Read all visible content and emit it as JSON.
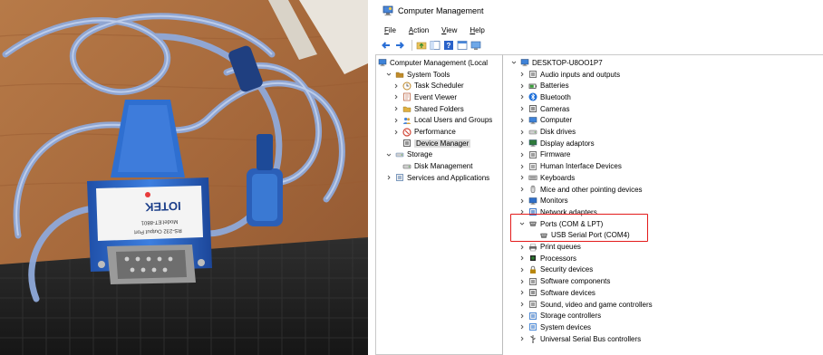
{
  "photo": {
    "adapter_brand": "IOTEK",
    "adapter_model": "Model:ET-8801",
    "adapter_port": "RS-232 Output Port",
    "colors": {
      "wood": "#a86a3c",
      "cable": "#8aa6d8",
      "adapter": "#2e68c8",
      "keyboard": "#242424"
    }
  },
  "window": {
    "title": "Computer Management",
    "menu": [
      "File",
      "Action",
      "View",
      "Help"
    ],
    "toolbar_icons": [
      "back-arrow-icon",
      "forward-arrow-icon",
      "up-folder-icon",
      "show-hide-tree-icon",
      "help-icon",
      "properties-icon",
      "console-icon"
    ],
    "left_tree": [
      {
        "label": "Computer Management (Local",
        "icon": "computer-management-icon",
        "chevron": "",
        "indent": 0
      },
      {
        "label": "System Tools",
        "icon": "tools-icon",
        "chevron": "v",
        "indent": 1
      },
      {
        "label": "Task Scheduler",
        "icon": "clock-icon",
        "chevron": ">",
        "indent": 2
      },
      {
        "label": "Event Viewer",
        "icon": "event-viewer-icon",
        "chevron": ">",
        "indent": 2
      },
      {
        "label": "Shared Folders",
        "icon": "shared-folder-icon",
        "chevron": ">",
        "indent": 2
      },
      {
        "label": "Local Users and Groups",
        "icon": "users-icon",
        "chevron": ">",
        "indent": 2
      },
      {
        "label": "Performance",
        "icon": "performance-icon",
        "chevron": ">",
        "indent": 2
      },
      {
        "label": "Device Manager",
        "icon": "device-manager-icon",
        "chevron": "",
        "indent": 2,
        "selected": true
      },
      {
        "label": "Storage",
        "icon": "storage-icon",
        "chevron": "v",
        "indent": 1
      },
      {
        "label": "Disk Management",
        "icon": "disk-management-icon",
        "chevron": "",
        "indent": 2
      },
      {
        "label": "Services and Applications",
        "icon": "services-icon",
        "chevron": ">",
        "indent": 1
      }
    ],
    "device_tree": {
      "root": "DESKTOP-U8OO1P7",
      "items": [
        {
          "label": "Audio inputs and outputs",
          "icon": "speaker-icon",
          "chevron": ">"
        },
        {
          "label": "Batteries",
          "icon": "battery-icon",
          "chevron": ">"
        },
        {
          "label": "Bluetooth",
          "icon": "bluetooth-icon",
          "chevron": ">"
        },
        {
          "label": "Cameras",
          "icon": "camera-icon",
          "chevron": ">"
        },
        {
          "label": "Computer",
          "icon": "computer-icon",
          "chevron": ">"
        },
        {
          "label": "Disk drives",
          "icon": "disk-drive-icon",
          "chevron": ">"
        },
        {
          "label": "Display adaptors",
          "icon": "display-adapter-icon",
          "chevron": ">"
        },
        {
          "label": "Firmware",
          "icon": "firmware-icon",
          "chevron": ">"
        },
        {
          "label": "Human Interface Devices",
          "icon": "hid-icon",
          "chevron": ">"
        },
        {
          "label": "Keyboards",
          "icon": "keyboard-icon",
          "chevron": ">"
        },
        {
          "label": "Mice and other pointing devices",
          "icon": "mouse-icon",
          "chevron": ">"
        },
        {
          "label": "Monitors",
          "icon": "monitor-icon",
          "chevron": ">"
        },
        {
          "label": "Network adapters",
          "icon": "network-icon",
          "chevron": ">"
        },
        {
          "label": "Ports (COM & LPT)",
          "icon": "port-icon",
          "chevron": "v"
        },
        {
          "label": "USB Serial Port (COM4)",
          "icon": "serial-port-icon",
          "chevron": "",
          "child": true
        },
        {
          "label": "Print queues",
          "icon": "printer-icon",
          "chevron": ">"
        },
        {
          "label": "Processors",
          "icon": "processor-icon",
          "chevron": ">"
        },
        {
          "label": "Security devices",
          "icon": "security-icon",
          "chevron": ">"
        },
        {
          "label": "Software components",
          "icon": "software-component-icon",
          "chevron": ">"
        },
        {
          "label": "Software devices",
          "icon": "software-device-icon",
          "chevron": ">"
        },
        {
          "label": "Sound, video and game controllers",
          "icon": "sound-icon",
          "chevron": ">"
        },
        {
          "label": "Storage controllers",
          "icon": "storage-controller-icon",
          "chevron": ">"
        },
        {
          "label": "System devices",
          "icon": "system-device-icon",
          "chevron": ">"
        },
        {
          "label": "Universal Serial Bus controllers",
          "icon": "usb-icon",
          "chevron": ">"
        }
      ]
    },
    "highlight_color": "#e31b1b"
  }
}
